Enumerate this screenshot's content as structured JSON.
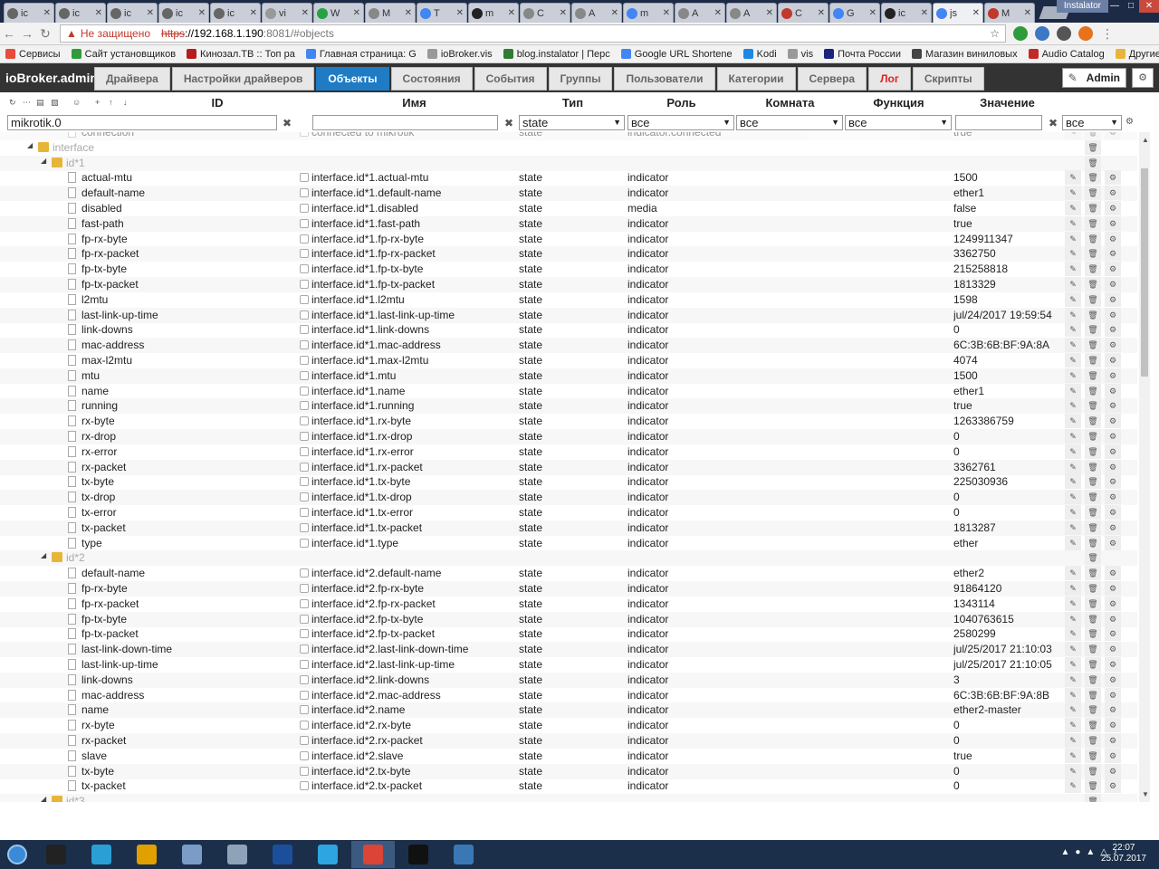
{
  "browser": {
    "tabs": [
      {
        "title": "ic",
        "icon": "gear-icon",
        "color": "#666"
      },
      {
        "title": "ic",
        "icon": "gear-icon",
        "color": "#666"
      },
      {
        "title": "ic",
        "icon": "gear-icon",
        "color": "#666"
      },
      {
        "title": "ic",
        "icon": "gear-icon",
        "color": "#666"
      },
      {
        "title": "ic",
        "icon": "gear-icon",
        "color": "#666"
      },
      {
        "title": "vi",
        "icon": "cloud-icon",
        "color": "#999"
      },
      {
        "title": "W",
        "icon": "whatsapp-icon",
        "color": "#25a244"
      },
      {
        "title": "M",
        "icon": "document-icon",
        "color": "#888"
      },
      {
        "title": "T",
        "icon": "google-icon",
        "color": "#4285f4"
      },
      {
        "title": "m",
        "icon": "github-icon",
        "color": "#222"
      },
      {
        "title": "C",
        "icon": "document-icon",
        "color": "#888"
      },
      {
        "title": "A",
        "icon": "document-icon",
        "color": "#888"
      },
      {
        "title": "m",
        "icon": "google-icon",
        "color": "#4285f4"
      },
      {
        "title": "A",
        "icon": "document-icon",
        "color": "#888"
      },
      {
        "title": "A",
        "icon": "document-icon",
        "color": "#888"
      },
      {
        "title": "C",
        "icon": "opera-icon",
        "color": "#c0392b"
      },
      {
        "title": "G",
        "icon": "translate-icon",
        "color": "#4285f4"
      },
      {
        "title": "ic",
        "icon": "github-icon",
        "color": "#222"
      },
      {
        "title": "js",
        "icon": "google-icon",
        "color": "#4285f4"
      },
      {
        "title": "M",
        "icon": "person-icon",
        "color": "#c0392b"
      }
    ],
    "window_label": "Instalator",
    "url": {
      "warning": "Не защищено",
      "protocol": "https",
      "host": "://192.168.1.190",
      "path": ":8081/#objects"
    },
    "bookmarks": [
      {
        "label": "Сервисы",
        "color": "#e74c3c"
      },
      {
        "label": "Сайт установщиков",
        "color": "#2e9c3a"
      },
      {
        "label": "Кинозал.ТВ :: Топ ра",
        "color": "#b71c1c"
      },
      {
        "label": "Главная страница: G",
        "color": "#4285f4"
      },
      {
        "label": "ioBroker.vis",
        "color": "#999"
      },
      {
        "label": "blog.instalator | Перс",
        "color": "#2e7d32"
      },
      {
        "label": "Google URL Shortene",
        "color": "#4285f4"
      },
      {
        "label": "Kodi",
        "color": "#1e88e5"
      },
      {
        "label": "vis",
        "color": "#999"
      },
      {
        "label": "Почта России",
        "color": "#1a237e"
      },
      {
        "label": "Магазин виниловых",
        "color": "#444"
      },
      {
        "label": "Audio Catalog",
        "color": "#c62828"
      }
    ],
    "bookmarks_other": "Другие закладки"
  },
  "app": {
    "brand": "ioBroker.admin",
    "tabs": [
      "Драйвера",
      "Настройки драйверов",
      "Объекты",
      "Состояния",
      "События",
      "Группы",
      "Пользователи",
      "Категории",
      "Сервера",
      "Лог",
      "Скрипты"
    ],
    "active_tab": "Объекты",
    "user": "Admin"
  },
  "columns": {
    "id": "ID",
    "name": "Имя",
    "type": "Тип",
    "role": "Роль",
    "room": "Комната",
    "function": "Функция",
    "value": "Значение"
  },
  "filters": {
    "id": "mikrotik.0",
    "name": "",
    "type": "state",
    "role": "все",
    "room": "все",
    "function": "все",
    "value": "",
    "last": "все"
  },
  "rows": [
    {
      "kind": "partial",
      "label": "connection",
      "name": "connected to mikrotik",
      "type": "state",
      "role": "indicator.connected",
      "value": "true"
    },
    {
      "kind": "folder",
      "level": 1,
      "label": "interface"
    },
    {
      "kind": "folder",
      "level": 2,
      "label": "id*1"
    },
    {
      "kind": "state",
      "label": "actual-mtu",
      "name": "interface.id*1.actual-mtu",
      "type": "state",
      "role": "indicator",
      "value": "1500"
    },
    {
      "kind": "state",
      "label": "default-name",
      "name": "interface.id*1.default-name",
      "type": "state",
      "role": "indicator",
      "value": "ether1"
    },
    {
      "kind": "state",
      "label": "disabled",
      "name": "interface.id*1.disabled",
      "type": "state",
      "role": "media",
      "value": "false"
    },
    {
      "kind": "state",
      "label": "fast-path",
      "name": "interface.id*1.fast-path",
      "type": "state",
      "role": "indicator",
      "value": "true"
    },
    {
      "kind": "state",
      "label": "fp-rx-byte",
      "name": "interface.id*1.fp-rx-byte",
      "type": "state",
      "role": "indicator",
      "value": "1249911347"
    },
    {
      "kind": "state",
      "label": "fp-rx-packet",
      "name": "interface.id*1.fp-rx-packet",
      "type": "state",
      "role": "indicator",
      "value": "3362750"
    },
    {
      "kind": "state",
      "label": "fp-tx-byte",
      "name": "interface.id*1.fp-tx-byte",
      "type": "state",
      "role": "indicator",
      "value": "215258818"
    },
    {
      "kind": "state",
      "label": "fp-tx-packet",
      "name": "interface.id*1.fp-tx-packet",
      "type": "state",
      "role": "indicator",
      "value": "1813329"
    },
    {
      "kind": "state",
      "label": "l2mtu",
      "name": "interface.id*1.l2mtu",
      "type": "state",
      "role": "indicator",
      "value": "1598"
    },
    {
      "kind": "state",
      "label": "last-link-up-time",
      "name": "interface.id*1.last-link-up-time",
      "type": "state",
      "role": "indicator",
      "value": "jul/24/2017 19:59:54"
    },
    {
      "kind": "state",
      "label": "link-downs",
      "name": "interface.id*1.link-downs",
      "type": "state",
      "role": "indicator",
      "value": "0"
    },
    {
      "kind": "state",
      "label": "mac-address",
      "name": "interface.id*1.mac-address",
      "type": "state",
      "role": "indicator",
      "value": "6C:3B:6B:BF:9A:8A"
    },
    {
      "kind": "state",
      "label": "max-l2mtu",
      "name": "interface.id*1.max-l2mtu",
      "type": "state",
      "role": "indicator",
      "value": "4074"
    },
    {
      "kind": "state",
      "label": "mtu",
      "name": "interface.id*1.mtu",
      "type": "state",
      "role": "indicator",
      "value": "1500"
    },
    {
      "kind": "state",
      "label": "name",
      "name": "interface.id*1.name",
      "type": "state",
      "role": "indicator",
      "value": "ether1"
    },
    {
      "kind": "state",
      "label": "running",
      "name": "interface.id*1.running",
      "type": "state",
      "role": "indicator",
      "value": "true"
    },
    {
      "kind": "state",
      "label": "rx-byte",
      "name": "interface.id*1.rx-byte",
      "type": "state",
      "role": "indicator",
      "value": "1263386759"
    },
    {
      "kind": "state",
      "label": "rx-drop",
      "name": "interface.id*1.rx-drop",
      "type": "state",
      "role": "indicator",
      "value": "0"
    },
    {
      "kind": "state",
      "label": "rx-error",
      "name": "interface.id*1.rx-error",
      "type": "state",
      "role": "indicator",
      "value": "0"
    },
    {
      "kind": "state",
      "label": "rx-packet",
      "name": "interface.id*1.rx-packet",
      "type": "state",
      "role": "indicator",
      "value": "3362761"
    },
    {
      "kind": "state",
      "label": "tx-byte",
      "name": "interface.id*1.tx-byte",
      "type": "state",
      "role": "indicator",
      "value": "225030936"
    },
    {
      "kind": "state",
      "label": "tx-drop",
      "name": "interface.id*1.tx-drop",
      "type": "state",
      "role": "indicator",
      "value": "0"
    },
    {
      "kind": "state",
      "label": "tx-error",
      "name": "interface.id*1.tx-error",
      "type": "state",
      "role": "indicator",
      "value": "0"
    },
    {
      "kind": "state",
      "label": "tx-packet",
      "name": "interface.id*1.tx-packet",
      "type": "state",
      "role": "indicator",
      "value": "1813287"
    },
    {
      "kind": "state",
      "label": "type",
      "name": "interface.id*1.type",
      "type": "state",
      "role": "indicator",
      "value": "ether"
    },
    {
      "kind": "folder",
      "level": 2,
      "label": "id*2"
    },
    {
      "kind": "state",
      "label": "default-name",
      "name": "interface.id*2.default-name",
      "type": "state",
      "role": "indicator",
      "value": "ether2"
    },
    {
      "kind": "state",
      "label": "fp-rx-byte",
      "name": "interface.id*2.fp-rx-byte",
      "type": "state",
      "role": "indicator",
      "value": "91864120"
    },
    {
      "kind": "state",
      "label": "fp-rx-packet",
      "name": "interface.id*2.fp-rx-packet",
      "type": "state",
      "role": "indicator",
      "value": "1343114"
    },
    {
      "kind": "state",
      "label": "fp-tx-byte",
      "name": "interface.id*2.fp-tx-byte",
      "type": "state",
      "role": "indicator",
      "value": "1040763615"
    },
    {
      "kind": "state",
      "label": "fp-tx-packet",
      "name": "interface.id*2.fp-tx-packet",
      "type": "state",
      "role": "indicator",
      "value": "2580299"
    },
    {
      "kind": "state",
      "label": "last-link-down-time",
      "name": "interface.id*2.last-link-down-time",
      "type": "state",
      "role": "indicator",
      "value": "jul/25/2017 21:10:03"
    },
    {
      "kind": "state",
      "label": "last-link-up-time",
      "name": "interface.id*2.last-link-up-time",
      "type": "state",
      "role": "indicator",
      "value": "jul/25/2017 21:10:05"
    },
    {
      "kind": "state",
      "label": "link-downs",
      "name": "interface.id*2.link-downs",
      "type": "state",
      "role": "indicator",
      "value": "3"
    },
    {
      "kind": "state",
      "label": "mac-address",
      "name": "interface.id*2.mac-address",
      "type": "state",
      "role": "indicator",
      "value": "6C:3B:6B:BF:9A:8B"
    },
    {
      "kind": "state",
      "label": "name",
      "name": "interface.id*2.name",
      "type": "state",
      "role": "indicator",
      "value": "ether2-master"
    },
    {
      "kind": "state",
      "label": "rx-byte",
      "name": "interface.id*2.rx-byte",
      "type": "state",
      "role": "indicator",
      "value": "0"
    },
    {
      "kind": "state",
      "label": "rx-packet",
      "name": "interface.id*2.rx-packet",
      "type": "state",
      "role": "indicator",
      "value": "0"
    },
    {
      "kind": "state",
      "label": "slave",
      "name": "interface.id*2.slave",
      "type": "state",
      "role": "indicator",
      "value": "true"
    },
    {
      "kind": "state",
      "label": "tx-byte",
      "name": "interface.id*2.tx-byte",
      "type": "state",
      "role": "indicator",
      "value": "0"
    },
    {
      "kind": "state",
      "label": "tx-packet",
      "name": "interface.id*2.tx-packet",
      "type": "state",
      "role": "indicator",
      "value": "0"
    },
    {
      "kind": "folder",
      "level": 2,
      "label": "id*3",
      "partial": true
    }
  ],
  "taskbar": {
    "apps": [
      {
        "icon": "terminal-icon",
        "color": "#222"
      },
      {
        "icon": "kodi-icon",
        "color": "#2a9fd6"
      },
      {
        "icon": "7zip-icon",
        "color": "#e0a000"
      },
      {
        "icon": "paint-icon",
        "color": "#7a9cc6"
      },
      {
        "icon": "calculator-icon",
        "color": "#8fa3b8"
      },
      {
        "icon": "floppy-icon",
        "color": "#1b4f9c"
      },
      {
        "icon": "telegram-icon",
        "color": "#2ca5e0"
      },
      {
        "icon": "chrome-icon",
        "color": "#db4437"
      },
      {
        "icon": "webstorm-icon",
        "color": "#111"
      },
      {
        "icon": "remote-desktop-icon",
        "color": "#3a78b5"
      }
    ],
    "time": "22:07",
    "date": "25.07.2017"
  }
}
